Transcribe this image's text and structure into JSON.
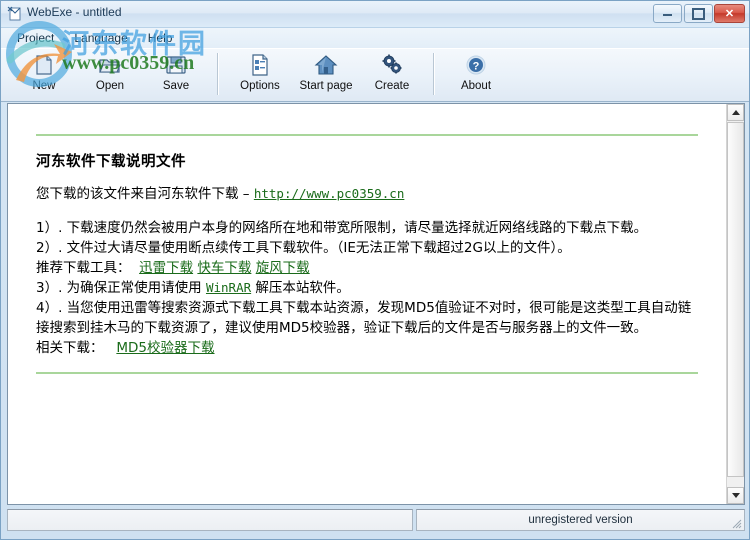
{
  "window": {
    "title": "WebExe - untitled",
    "icon": "app-icon",
    "controls": {
      "minimize": "–",
      "maximize": "□",
      "close": "✕"
    }
  },
  "menu": {
    "items": [
      {
        "label": "Project",
        "name": "menu-project"
      },
      {
        "label": "Language",
        "name": "menu-language"
      },
      {
        "label": "Help",
        "name": "menu-help"
      }
    ]
  },
  "toolbar": {
    "buttons": [
      {
        "label": "New",
        "icon": "new-file-icon"
      },
      {
        "label": "Open",
        "icon": "open-folder-icon"
      },
      {
        "label": "Save",
        "icon": "save-disk-icon"
      },
      {
        "label": "Options",
        "icon": "options-document-icon"
      },
      {
        "label": "Start page",
        "icon": "home-icon"
      },
      {
        "label": "Create",
        "icon": "gears-icon"
      },
      {
        "label": "About",
        "icon": "help-question-icon"
      }
    ]
  },
  "document": {
    "heading": "河东软件下载说明文件",
    "subtitle_prefix": "您下载的该文件来自河东软件下载 – ",
    "subtitle_link": "http://www.pc0359.cn",
    "item1": "1）. 下载速度仍然会被用户本身的网络所在地和带宽所限制，请尽量选择就近网络线路的下载点下载。",
    "item2": "2）. 文件过大请尽量使用断点续传工具下载软件。（IE无法正常下载超过2G以上的文件）。",
    "tools_label": "推荐下载工具：",
    "tools": [
      "迅雷下载",
      "快车下载",
      "旋风下载"
    ],
    "item3_prefix": "3）. 为确保正常使用请使用 ",
    "item3_link": "WinRAR",
    "item3_suffix": " 解压本站软件。",
    "item4": "4）. 当您使用迅雷等搜索资源式下载工具下载本站资源，发现MD5值验证不对时，很可能是这类型工具自动链接搜索到挂木马的下载资源了，建议使用MD5校验器，验证下载后的文件是否与服务器上的文件一致。",
    "related_label": "相关下载：",
    "related_link": "MD5校验器下载"
  },
  "scrollbar": {
    "up_arrow": "▲",
    "down_arrow": "▼"
  },
  "statusbar": {
    "left": "",
    "right": "unregistered version"
  },
  "watermark": {
    "site_name": "河东软件园",
    "site_url": "www.pc0359.cn"
  },
  "colors": {
    "link_green": "#1a6b1a",
    "rule_green": "#a9d69b",
    "watermark_blue": "#3f9fe0",
    "watermark_green": "#1f7a1f",
    "close_red": "#c4382a"
  }
}
